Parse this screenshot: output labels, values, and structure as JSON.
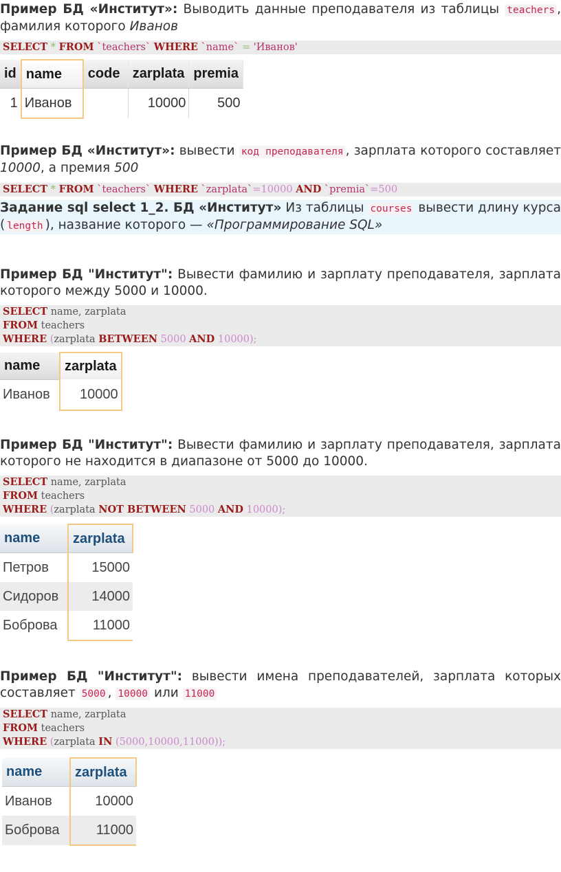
{
  "ex1": {
    "label": "Пример БД «Институт»:",
    "text": "Выводить данные преподавателя из таблицы",
    "code_word": "teachers",
    "text2": ", фамилия которого",
    "name": "Иванов",
    "sql": {
      "k1": "SELECT",
      "star": "*",
      "k2": "FROM",
      "tbl": "`teachers`",
      "k3": "WHERE",
      "col": "`name`",
      "eq": "=",
      "val": "'Иванов'"
    },
    "table": {
      "headers": [
        "id",
        "name",
        "code",
        "zarplata",
        "premia"
      ],
      "rows": [
        [
          "1",
          "Иванов",
          "",
          "10000",
          "500"
        ]
      ]
    }
  },
  "ex2": {
    "label": "Пример БД «Институт»:",
    "text": "вывести",
    "code_word": "код преподавателя",
    "text2": ", зарплата которого составляет",
    "v1": "10000",
    "text3": ", а премия",
    "v2": "500",
    "sql": {
      "k1": "SELECT",
      "star": "*",
      "k2": "FROM",
      "tbl": "`teachers`",
      "k3": "WHERE",
      "c1": "`zarplata`",
      "e1": "=",
      "n1": "10000",
      "k4": "AND",
      "c2": "`premia`",
      "e2": "=",
      "n2": "500"
    }
  },
  "task": {
    "label": "Задание sql select 1_2. БД «Институт»",
    "text": "Из таблицы",
    "code1": "courses",
    "text2": "вывести длину курса (",
    "code2": "length",
    "text3": "), название которого —",
    "title": "«Программирование SQL»"
  },
  "ex3": {
    "label": "Пример БД \"Институт\":",
    "text": "Вывести фамилию и зарплату преподавателя, зарплата которого между 5000 и 10000.",
    "sql": {
      "k1": "SELECT",
      "f": "name, zarplata",
      "k2": "FROM",
      "t": "teachers",
      "k3": "WHERE",
      "p1": "(",
      "c": "zarplata",
      "k4": "BETWEEN",
      "n1": "5000",
      "k5": "AND",
      "n2": "10000",
      "p2": ");"
    },
    "table": {
      "headers": [
        "name",
        "zarplata"
      ],
      "rows": [
        [
          "Иванов",
          "10000"
        ]
      ]
    }
  },
  "ex4": {
    "label": "Пример БД \"Институт\":",
    "text": "Вывести фамилию и зарплату преподавателя, зарплата которого не находится в диапазоне от 5000 до 10000.",
    "sql": {
      "k1": "SELECT",
      "f": "name, zarplata",
      "k2": "FROM",
      "t": "teachers",
      "k3": "WHERE",
      "p1": "(",
      "c": "zarplata",
      "k4": "NOT BETWEEN",
      "n1": "5000",
      "k5": "AND",
      "n2": "10000",
      "p2": ");"
    },
    "table": {
      "headers": [
        "name",
        "zarplata"
      ],
      "rows": [
        [
          "Петров",
          "15000"
        ],
        [
          "Сидоров",
          "14000"
        ],
        [
          "Боброва",
          "11000"
        ]
      ]
    }
  },
  "ex5": {
    "label": "Пример БД \"Институт\":",
    "text": "вывести имена преподавателей, зарплата которых составляет",
    "c1": "5000",
    "sep1": ",",
    "c2": "10000",
    "sep2": "или",
    "c3": "11000",
    "sql": {
      "k1": "SELECT",
      "f": "name, zarplata",
      "k2": "FROM",
      "t": "teachers",
      "k3": "WHERE",
      "p1": "(",
      "c": "zarplata",
      "k4": "IN",
      "vals": "(5000,10000,11000));"
    },
    "table": {
      "headers": [
        "name",
        "zarplata"
      ],
      "rows": [
        [
          "Иванов",
          "10000"
        ],
        [
          "Боброва",
          "11000"
        ]
      ]
    }
  }
}
